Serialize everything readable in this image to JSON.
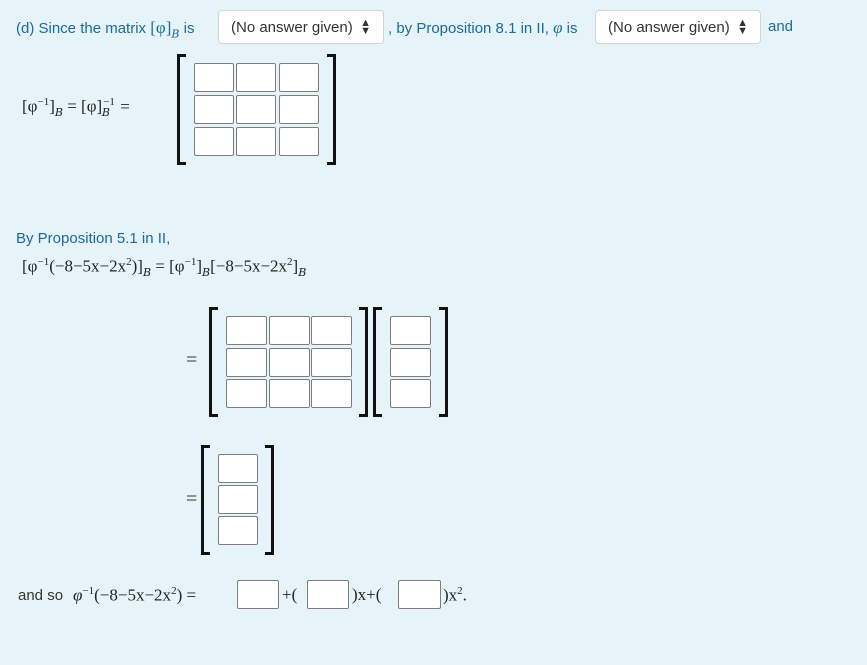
{
  "line1": {
    "prefix": "(d)  Since the matrix",
    "matrix_symbol": "[φ]",
    "matrix_sub": "B",
    "is_text": "is",
    "select1": {
      "value": "(No answer given)",
      "arrows": "▴▾"
    },
    "middle": ", by Proposition 8.1 in II,",
    "phi": "φ",
    "is_text2": "is",
    "select2": {
      "value": "(No answer given)",
      "arrows": "▴▾"
    },
    "suffix": "and"
  },
  "inverse_eq": {
    "lhs": "[φ",
    "lhs_sup": "−1",
    "lhs_close": "]",
    "lhs_sub": "B",
    "mid": " = [φ]",
    "mid_sup": "−1",
    "mid_sub": "B",
    "rhs": " ="
  },
  "prop51": {
    "label": "By Proposition 5.1 in II,",
    "eq_lhs_open": "[φ",
    "eq_lhs_sup": "−1",
    "eq_lhs_poly": "(−8−5x−2x",
    "eq_lhs_sq": "2",
    "eq_lhs_close": ")]",
    "eq_sub": "B",
    "eq_mid": " = [φ",
    "eq_mid_sup": "−1",
    "eq_mid_close": "]",
    "eq_mid_sub": "B",
    "eq_rhs_poly": "[−8−5x−2x",
    "eq_rhs_sq": "2",
    "eq_rhs_close": "]",
    "eq_rhs_sub": "B",
    "equals": "="
  },
  "result": {
    "and_so": "and so",
    "phi": "φ",
    "sup": "−1",
    "poly": "(−8−5x−2x",
    "sq": "2",
    "close": ") =",
    "plus1": "+(",
    "x_part": ")x+(",
    "x2_part": ")x",
    "x2_sup": "2",
    "period": "."
  },
  "equals_sign": "="
}
